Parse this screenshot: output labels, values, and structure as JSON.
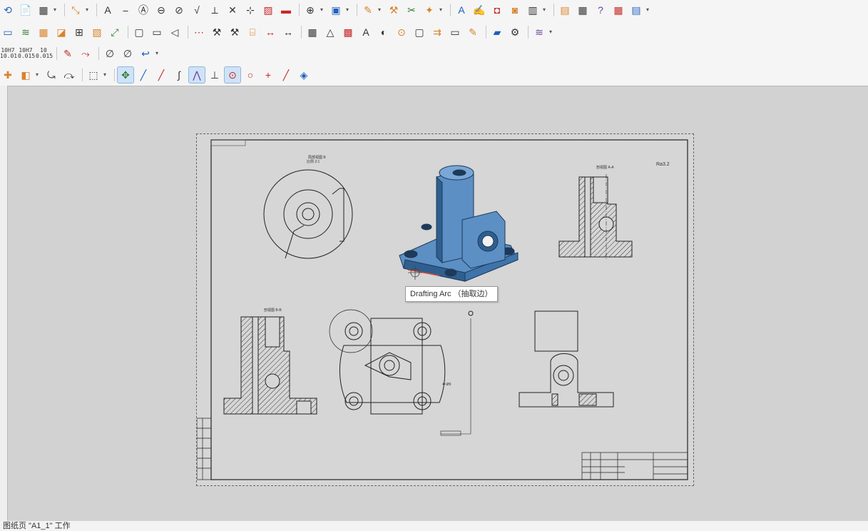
{
  "toolbar": {
    "row1": [
      {
        "name": "section-view-icon",
        "glyph": "⟲",
        "color": "blue"
      },
      {
        "name": "new-sheet-icon",
        "glyph": "📄",
        "color": "orange"
      },
      {
        "name": "view-manager-icon",
        "glyph": "▦",
        "color": ""
      },
      {
        "name": "dropdown",
        "glyph": "▾",
        "drop": true
      },
      {
        "name": "sep",
        "sep": true
      },
      {
        "name": "projection-view-icon",
        "glyph": "⤡",
        "color": "orange"
      },
      {
        "name": "dropdown",
        "glyph": "▾",
        "drop": true
      },
      {
        "name": "sep",
        "sep": true
      },
      {
        "name": "text-annotation-icon",
        "glyph": "A",
        "color": ""
      },
      {
        "name": "leader-icon",
        "glyph": "⎯",
        "color": ""
      },
      {
        "name": "balloon-icon",
        "glyph": "Ⓐ",
        "color": ""
      },
      {
        "name": "zoom-out-icon",
        "glyph": "⊖",
        "color": ""
      },
      {
        "name": "datum-feature-icon",
        "glyph": "⊘",
        "color": ""
      },
      {
        "name": "surface-finish-icon",
        "glyph": "√",
        "color": ""
      },
      {
        "name": "weld-symbol-icon",
        "glyph": "⟂",
        "color": ""
      },
      {
        "name": "cross-mark-icon",
        "glyph": "✕",
        "color": ""
      },
      {
        "name": "centerline-icon",
        "glyph": "⊹",
        "color": ""
      },
      {
        "name": "hatch-icon",
        "glyph": "▨",
        "color": "red"
      },
      {
        "name": "fill-icon",
        "glyph": "▬",
        "color": "red"
      },
      {
        "name": "sep",
        "sep": true
      },
      {
        "name": "center-mark-icon",
        "glyph": "⊕",
        "color": ""
      },
      {
        "name": "dropdown",
        "glyph": "▾",
        "drop": true
      },
      {
        "name": "image-icon",
        "glyph": "▣",
        "color": "blue"
      },
      {
        "name": "dropdown",
        "glyph": "▾",
        "drop": true
      },
      {
        "name": "sep",
        "sep": true
      },
      {
        "name": "edit-model-icon",
        "glyph": "✎",
        "color": "orange"
      },
      {
        "name": "dropdown",
        "glyph": "▾",
        "drop": true
      },
      {
        "name": "modify-view-icon",
        "glyph": "⚒",
        "color": "orange"
      },
      {
        "name": "replace-model-icon",
        "glyph": "✂",
        "color": "green"
      },
      {
        "name": "update-model-icon",
        "glyph": "✦",
        "color": "orange"
      },
      {
        "name": "dropdown",
        "glyph": "▾",
        "drop": true
      },
      {
        "name": "sep",
        "sep": true
      },
      {
        "name": "text-style-icon",
        "glyph": "A",
        "color": "blue"
      },
      {
        "name": "annotation-settings-icon",
        "glyph": "✍",
        "color": "orange"
      },
      {
        "name": "insert-block-icon",
        "glyph": "◘",
        "color": "red"
      },
      {
        "name": "insert-3d-block-icon",
        "glyph": "◙",
        "color": "orange"
      },
      {
        "name": "catalog-icon",
        "glyph": "▥",
        "color": ""
      },
      {
        "name": "dropdown",
        "glyph": "▾",
        "drop": true
      },
      {
        "name": "sep",
        "sep": true
      },
      {
        "name": "title-block-icon",
        "glyph": "▤",
        "color": "orange"
      },
      {
        "name": "bom-icon",
        "glyph": "▦",
        "color": ""
      },
      {
        "name": "help-icon",
        "glyph": "?",
        "color": "purple"
      },
      {
        "name": "calendar-table-icon",
        "glyph": "▦",
        "color": "red"
      },
      {
        "name": "table-icon",
        "glyph": "▤",
        "color": "blue"
      },
      {
        "name": "dropdown",
        "glyph": "▾",
        "drop": true
      }
    ],
    "row2": [
      {
        "name": "sheet-properties-icon",
        "glyph": "▭",
        "color": "blue"
      },
      {
        "name": "layers-icon",
        "glyph": "≋",
        "color": "green"
      },
      {
        "name": "drawing-frame-icon",
        "glyph": "▦",
        "color": "orange"
      },
      {
        "name": "filter-icon",
        "glyph": "◪",
        "color": "orange"
      },
      {
        "name": "structure-tree-icon",
        "glyph": "⊞",
        "color": ""
      },
      {
        "name": "properties-icon",
        "glyph": "▧",
        "color": "orange"
      },
      {
        "name": "transform-icon",
        "glyph": "⤢",
        "color": "green"
      },
      {
        "name": "sep",
        "sep": true
      },
      {
        "name": "frame-icon",
        "glyph": "▢",
        "color": ""
      },
      {
        "name": "window-icon",
        "glyph": "▭",
        "color": ""
      },
      {
        "name": "back-icon",
        "glyph": "◁",
        "color": ""
      },
      {
        "name": "sep",
        "sep": true
      },
      {
        "name": "grid-icon",
        "glyph": "⋯",
        "color": "red"
      },
      {
        "name": "tolerance-icon",
        "glyph": "⚒",
        "color": ""
      },
      {
        "name": "fit-tolerance-icon",
        "glyph": "⚒",
        "color": ""
      },
      {
        "name": "hole-table-icon",
        "glyph": "⌸",
        "color": "orange"
      },
      {
        "name": "baseline-dim-icon",
        "glyph": "↔",
        "color": "red"
      },
      {
        "name": "text-dim-icon",
        "glyph": "↔",
        "color": ""
      },
      {
        "name": "sep",
        "sep": true
      },
      {
        "name": "coordinate-table-icon",
        "glyph": "▦",
        "color": ""
      },
      {
        "name": "triangle-icon",
        "glyph": "△",
        "color": ""
      },
      {
        "name": "chart-icon",
        "glyph": "▩",
        "color": "red"
      },
      {
        "name": "text-arrow-icon",
        "glyph": "A",
        "color": ""
      },
      {
        "name": "shading-icon",
        "glyph": "◐",
        "color": ""
      },
      {
        "name": "xyz-icon",
        "glyph": "⊙",
        "color": "orange"
      },
      {
        "name": "rectangle-icon",
        "glyph": "▢",
        "color": ""
      },
      {
        "name": "callout-icon",
        "glyph": "⇉",
        "color": "orange"
      },
      {
        "name": "note-icon",
        "glyph": "▭",
        "color": ""
      },
      {
        "name": "paint-icon",
        "glyph": "✎",
        "color": "orange"
      },
      {
        "name": "sep",
        "sep": true
      },
      {
        "name": "tag-icon",
        "glyph": "▰",
        "color": "blue"
      },
      {
        "name": "settings-icon",
        "glyph": "⚙",
        "color": ""
      },
      {
        "name": "sep",
        "sep": true
      },
      {
        "name": "spring-icon",
        "glyph": "≋",
        "color": "purple"
      },
      {
        "name": "dropdown",
        "glyph": "▾",
        "drop": true
      }
    ],
    "row3": [
      {
        "name": "fit-10h7-icon",
        "txt": "10H7\n10.01",
        "color": ""
      },
      {
        "name": "fit-10h7-icon",
        "txt": "10H7\n0.015",
        "color": ""
      },
      {
        "name": "fit-10-icon",
        "txt": "10\n0.015",
        "color": ""
      },
      {
        "name": "sep",
        "sep": true
      },
      {
        "name": "dimension-edit-icon",
        "glyph": "✎",
        "color": "red"
      },
      {
        "name": "dimension-value-icon",
        "glyph": "⤳",
        "color": "red"
      },
      {
        "name": "sep",
        "sep": true
      },
      {
        "name": "diameter-icon",
        "glyph": "∅",
        "color": ""
      },
      {
        "name": "diameter-alt-icon",
        "glyph": "∅",
        "color": ""
      },
      {
        "name": "undo-icon",
        "glyph": "↩",
        "color": "blue"
      },
      {
        "name": "dropdown",
        "glyph": "▾",
        "drop": true
      }
    ],
    "row4": [
      {
        "name": "pick-filter-icon",
        "glyph": "✚",
        "color": "orange"
      },
      {
        "name": "select-filter-icon",
        "glyph": "◧",
        "color": "orange"
      },
      {
        "name": "dropdown",
        "glyph": "▾",
        "drop": true
      },
      {
        "name": "snap-icon",
        "glyph": "⤿",
        "color": ""
      },
      {
        "name": "snap-alt-icon",
        "glyph": "⤼",
        "color": ""
      },
      {
        "name": "sep",
        "sep": true
      },
      {
        "name": "box-select-icon",
        "glyph": "⬚",
        "color": ""
      },
      {
        "name": "dropdown",
        "glyph": "▾",
        "drop": true
      },
      {
        "name": "sep",
        "sep": true
      },
      {
        "name": "snap-points-icon",
        "glyph": "✥",
        "color": "green",
        "active": true
      },
      {
        "name": "line-icon",
        "glyph": "╱",
        "color": "blue"
      },
      {
        "name": "line-point-icon",
        "glyph": "╱",
        "color": "red"
      },
      {
        "name": "curve-icon",
        "glyph": "∫",
        "color": ""
      },
      {
        "name": "polyline-icon",
        "glyph": "⋀",
        "color": "purple",
        "active": true
      },
      {
        "name": "tangent-icon",
        "glyph": "⊥",
        "color": ""
      },
      {
        "name": "drafting-arc-icon",
        "glyph": "⊙",
        "color": "red",
        "active": true
      },
      {
        "name": "circle-icon",
        "glyph": "○",
        "color": "red"
      },
      {
        "name": "cross-icon",
        "glyph": "+",
        "color": "red"
      },
      {
        "name": "segment-icon",
        "glyph": "╱",
        "color": "red"
      },
      {
        "name": "extrude-icon",
        "glyph": "◈",
        "color": "blue"
      }
    ]
  },
  "drawing": {
    "view_labels": [
      "局部视图 B",
      "比例 2:1",
      "剖视图 A-A",
      "剖视图 B-B",
      "Ra3.2"
    ],
    "dim_label": "4×Ø9"
  },
  "tooltip": {
    "text": "Drafting Arc （抽取边）"
  },
  "status_bar": {
    "text": "图纸页 \"A1_1\" 工作"
  },
  "colors": {
    "part_fill": "#5c8fc4",
    "part_dark": "#2f5f8f",
    "canvas": "#d2d2d2",
    "accent_red": "#d24a3a"
  }
}
